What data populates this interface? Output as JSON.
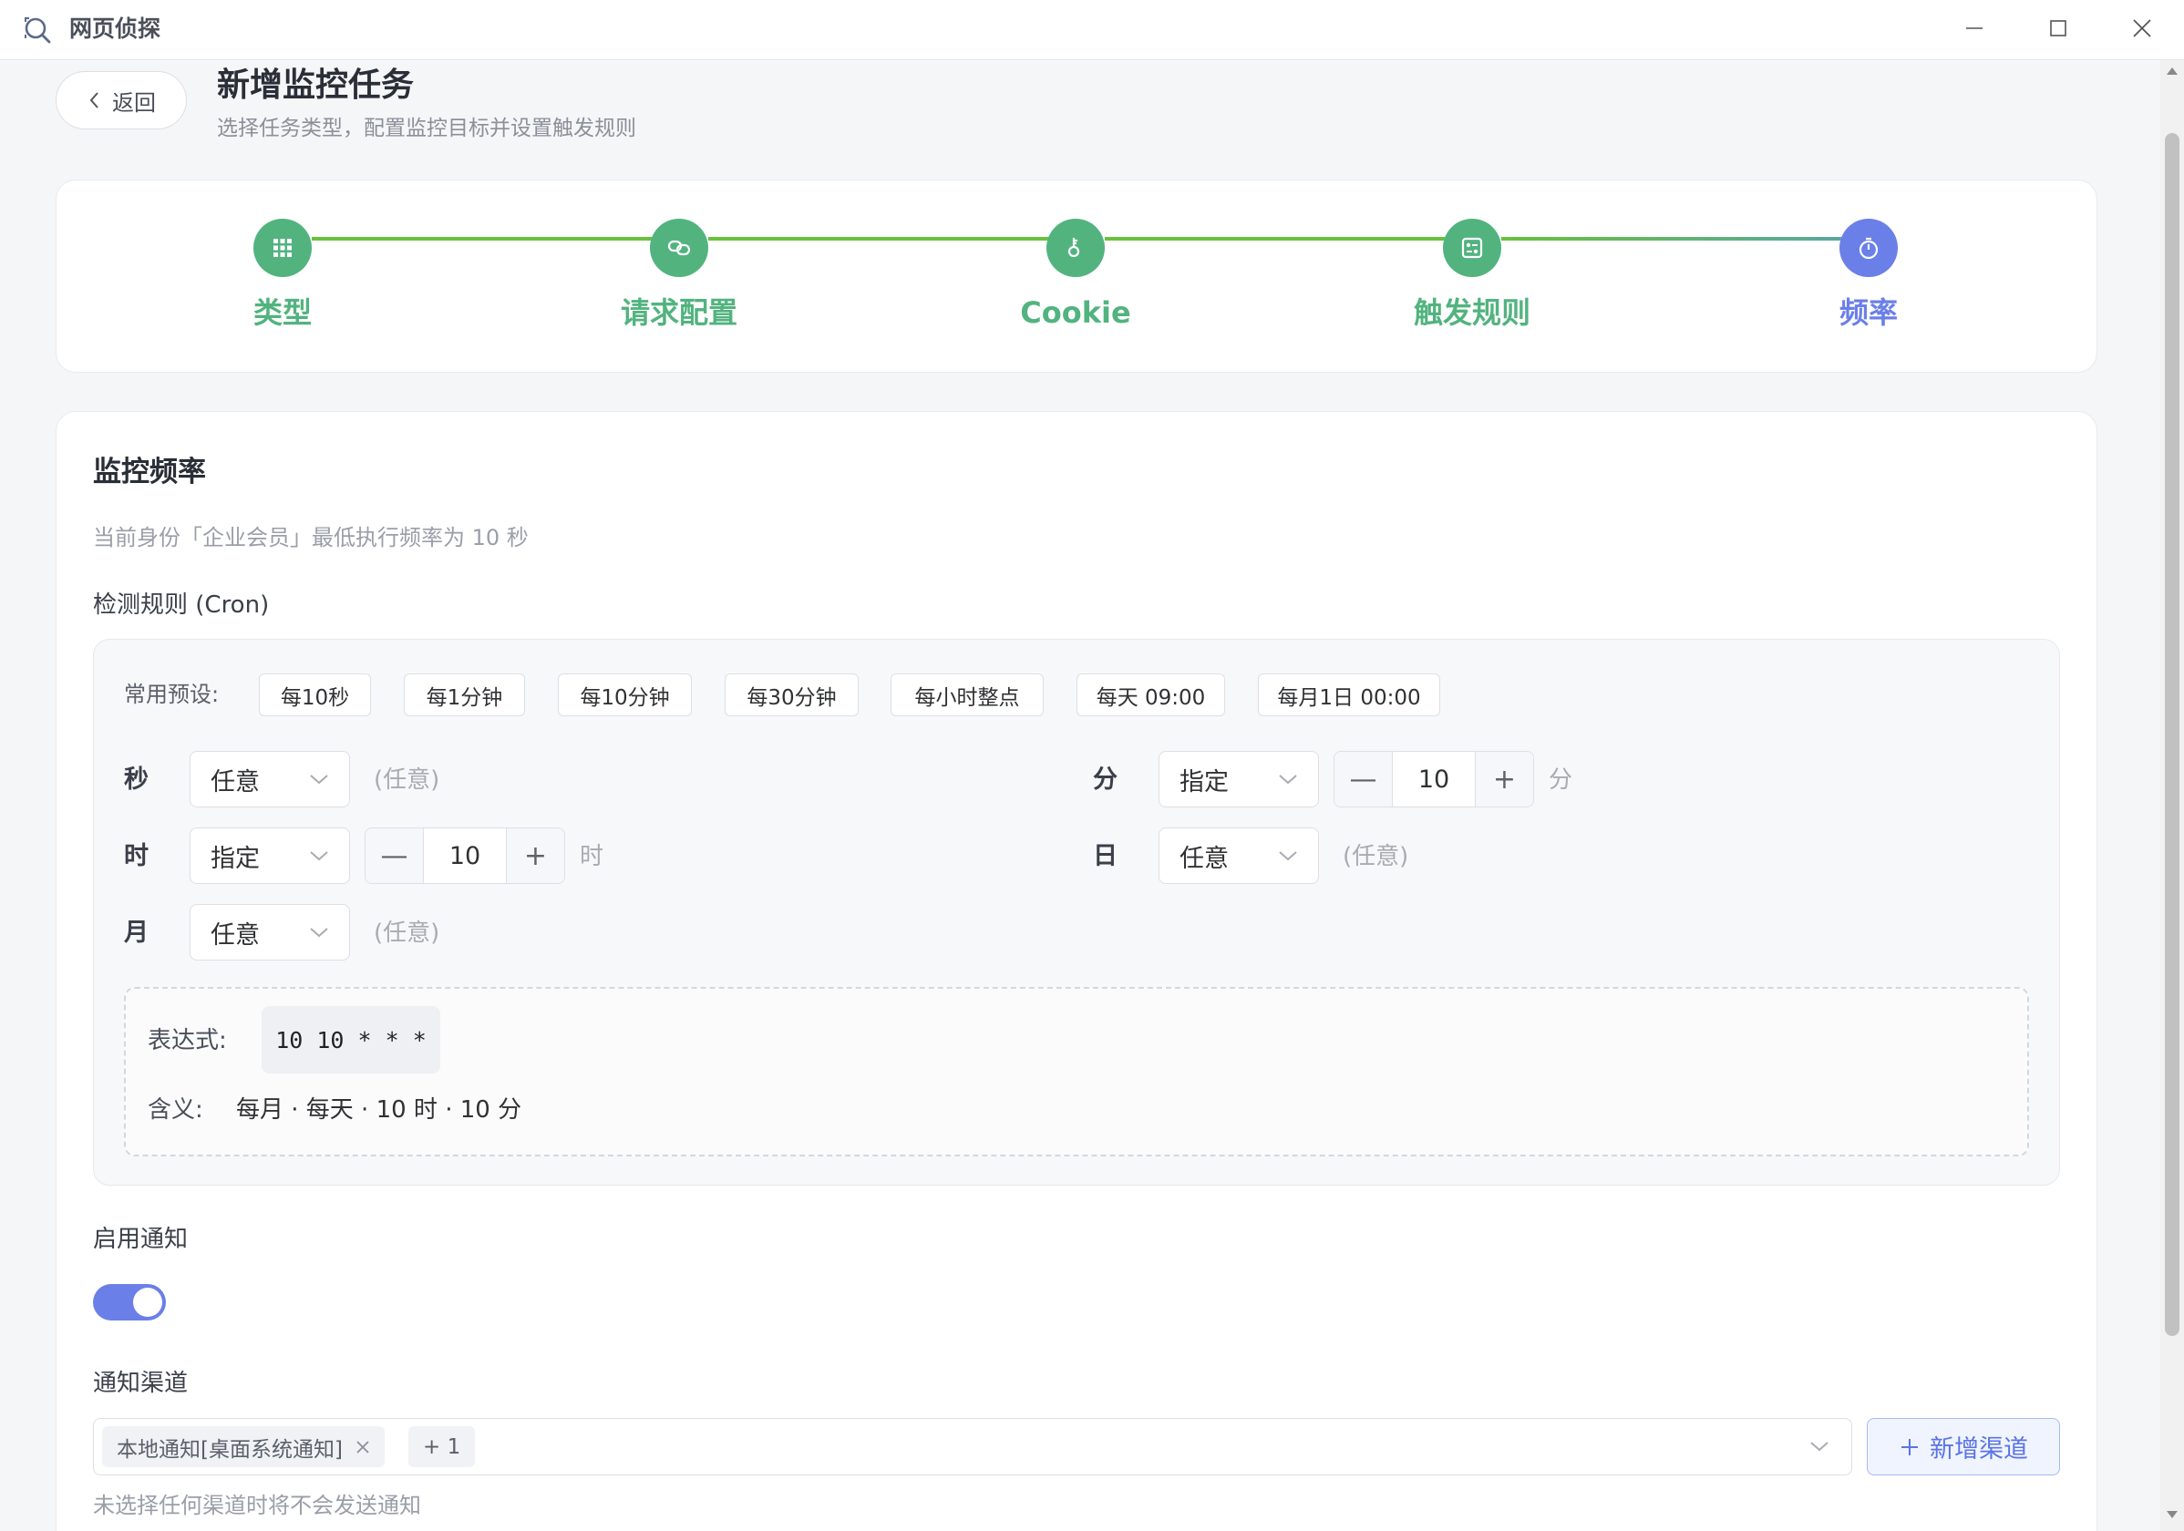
{
  "window": {
    "app_title": "网页侦探"
  },
  "header": {
    "back_label": "返回",
    "title": "新增监控任务",
    "subtitle": "选择任务类型，配置监控目标并设置触发规则"
  },
  "steps": [
    {
      "label": "类型",
      "icon": "grid-icon",
      "color": "#52b37f"
    },
    {
      "label": "请求配置",
      "icon": "link-icon",
      "color": "#52b37f"
    },
    {
      "label": "Cookie",
      "icon": "key-icon",
      "color": "#52b37f"
    },
    {
      "label": "触发规则",
      "icon": "rules-icon",
      "color": "#52b37f"
    },
    {
      "label": "频率",
      "icon": "timer-icon",
      "color": "#6b7fe8"
    }
  ],
  "frequency": {
    "section_title": "监控频率",
    "hint": "当前身份「企业会员」最低执行频率为 10 秒",
    "cron_label": "检测规则 (Cron)",
    "presets_label": "常用预设:",
    "presets": [
      "每10秒",
      "每1分钟",
      "每10分钟",
      "每30分钟",
      "每小时整点",
      "每天 09:00",
      "每月1日 00:00"
    ],
    "fields": {
      "second": {
        "label": "秒",
        "mode": "任意",
        "note": "(任意)"
      },
      "minute": {
        "label": "分",
        "mode": "指定",
        "value": "10",
        "unit": "分"
      },
      "hour": {
        "label": "时",
        "mode": "指定",
        "value": "10",
        "unit": "时"
      },
      "day": {
        "label": "日",
        "mode": "任意",
        "note": "(任意)"
      },
      "month": {
        "label": "月",
        "mode": "任意",
        "note": "(任意)"
      }
    },
    "stepper_minus": "—",
    "stepper_plus": "+",
    "expression_label": "表达式:",
    "expression": "10 10 * * *",
    "meaning_label": "含义:",
    "meaning": "每月 · 每天 · 10 时 · 10 分"
  },
  "notification": {
    "enable_label": "启用通知",
    "enabled": true,
    "channel_label": "通知渠道",
    "selected_tag": "本地通知[桌面系统通知]",
    "more_tag": "+ 1",
    "add_channel_label": "新增渠道",
    "helper": "未选择任何渠道时将不会发送通知"
  },
  "colors": {
    "accent": "#6b7fe8",
    "done": "#52b37f",
    "line": "#67c23a"
  }
}
